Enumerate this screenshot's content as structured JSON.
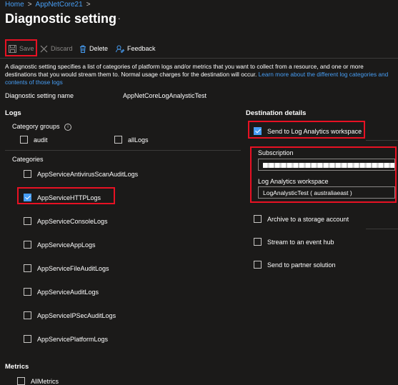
{
  "breadcrumb": {
    "home": "Home",
    "sep": ">",
    "resource": "AppNetCore21",
    "sep2": ">"
  },
  "page": {
    "title": "Diagnostic setting",
    "more": "···"
  },
  "toolbar": {
    "save": "Save",
    "discard": "Discard",
    "delete": "Delete",
    "feedback": "Feedback"
  },
  "description": {
    "text": "A diagnostic setting specifies a list of categories of platform logs and/or metrics that you want to collect from a resource, and one or more destinations that you would stream them to. Normal usage charges for the destination will occur.",
    "link": "Learn more about the different log categories and contents of those logs"
  },
  "setting_name": {
    "label": "Diagnostic setting name",
    "value": "AppNetCoreLogAnalysticTest"
  },
  "logs": {
    "header": "Logs",
    "category_groups_label": "Category groups",
    "groups": [
      {
        "label": "audit",
        "checked": false
      },
      {
        "label": "allLogs",
        "checked": false
      }
    ],
    "categories_label": "Categories",
    "categories": [
      {
        "label": "AppServiceAntivirusScanAuditLogs",
        "checked": false
      },
      {
        "label": "AppServiceHTTPLogs",
        "checked": true
      },
      {
        "label": "AppServiceConsoleLogs",
        "checked": false
      },
      {
        "label": "AppServiceAppLogs",
        "checked": false
      },
      {
        "label": "AppServiceFileAuditLogs",
        "checked": false
      },
      {
        "label": "AppServiceAuditLogs",
        "checked": false
      },
      {
        "label": "AppServiceIPSecAuditLogs",
        "checked": false
      },
      {
        "label": "AppServicePlatformLogs",
        "checked": false
      }
    ]
  },
  "metrics": {
    "header": "Metrics",
    "all_metrics": "AllMetrics"
  },
  "destination": {
    "header": "Destination details",
    "send_to_la": {
      "label": "Send to Log Analytics workspace",
      "checked": true
    },
    "subscription_label": "Subscription",
    "workspace_label": "Log Analytics workspace",
    "workspace_value": "LogAnalysticTest ( australiaeast )",
    "options": [
      {
        "label": "Archive to a storage account",
        "checked": false
      },
      {
        "label": "Stream to an event hub",
        "checked": false
      },
      {
        "label": "Send to partner solution",
        "checked": false
      }
    ]
  },
  "colors": {
    "background": "#1b1a19",
    "accent": "#479ef5",
    "highlight": "#e81123"
  }
}
